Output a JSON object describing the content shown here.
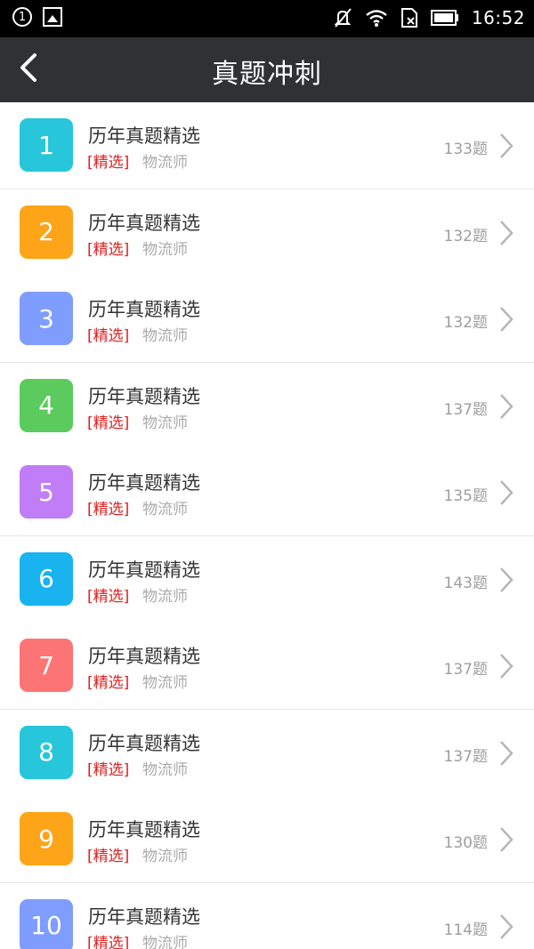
{
  "status": {
    "notification_count": "1",
    "time": "16:52"
  },
  "header": {
    "title": "真题冲刺"
  },
  "rows": [
    {
      "number": "1",
      "title": "历年真题精选",
      "tag": "[精选]",
      "category": "物流师",
      "count": "133题",
      "color": "#27c6da"
    },
    {
      "number": "2",
      "title": "历年真题精选",
      "tag": "[精选]",
      "category": "物流师",
      "count": "132题",
      "color": "#fea419"
    },
    {
      "number": "3",
      "title": "历年真题精选",
      "tag": "[精选]",
      "category": "物流师",
      "count": "132题",
      "color": "#7f9cff"
    },
    {
      "number": "4",
      "title": "历年真题精选",
      "tag": "[精选]",
      "category": "物流师",
      "count": "137题",
      "color": "#5acb5c"
    },
    {
      "number": "5",
      "title": "历年真题精选",
      "tag": "[精选]",
      "category": "物流师",
      "count": "135题",
      "color": "#c17df7"
    },
    {
      "number": "6",
      "title": "历年真题精选",
      "tag": "[精选]",
      "category": "物流师",
      "count": "143题",
      "color": "#19b3ef"
    },
    {
      "number": "7",
      "title": "历年真题精选",
      "tag": "[精选]",
      "category": "物流师",
      "count": "137题",
      "color": "#fd7474"
    },
    {
      "number": "8",
      "title": "历年真题精选",
      "tag": "[精选]",
      "category": "物流师",
      "count": "137题",
      "color": "#27c6da"
    },
    {
      "number": "9",
      "title": "历年真题精选",
      "tag": "[精选]",
      "category": "物流师",
      "count": "130题",
      "color": "#fea419"
    },
    {
      "number": "10",
      "title": "历年真题精选",
      "tag": "[精选]",
      "category": "物流师",
      "count": "114题",
      "color": "#7f9cff"
    }
  ]
}
